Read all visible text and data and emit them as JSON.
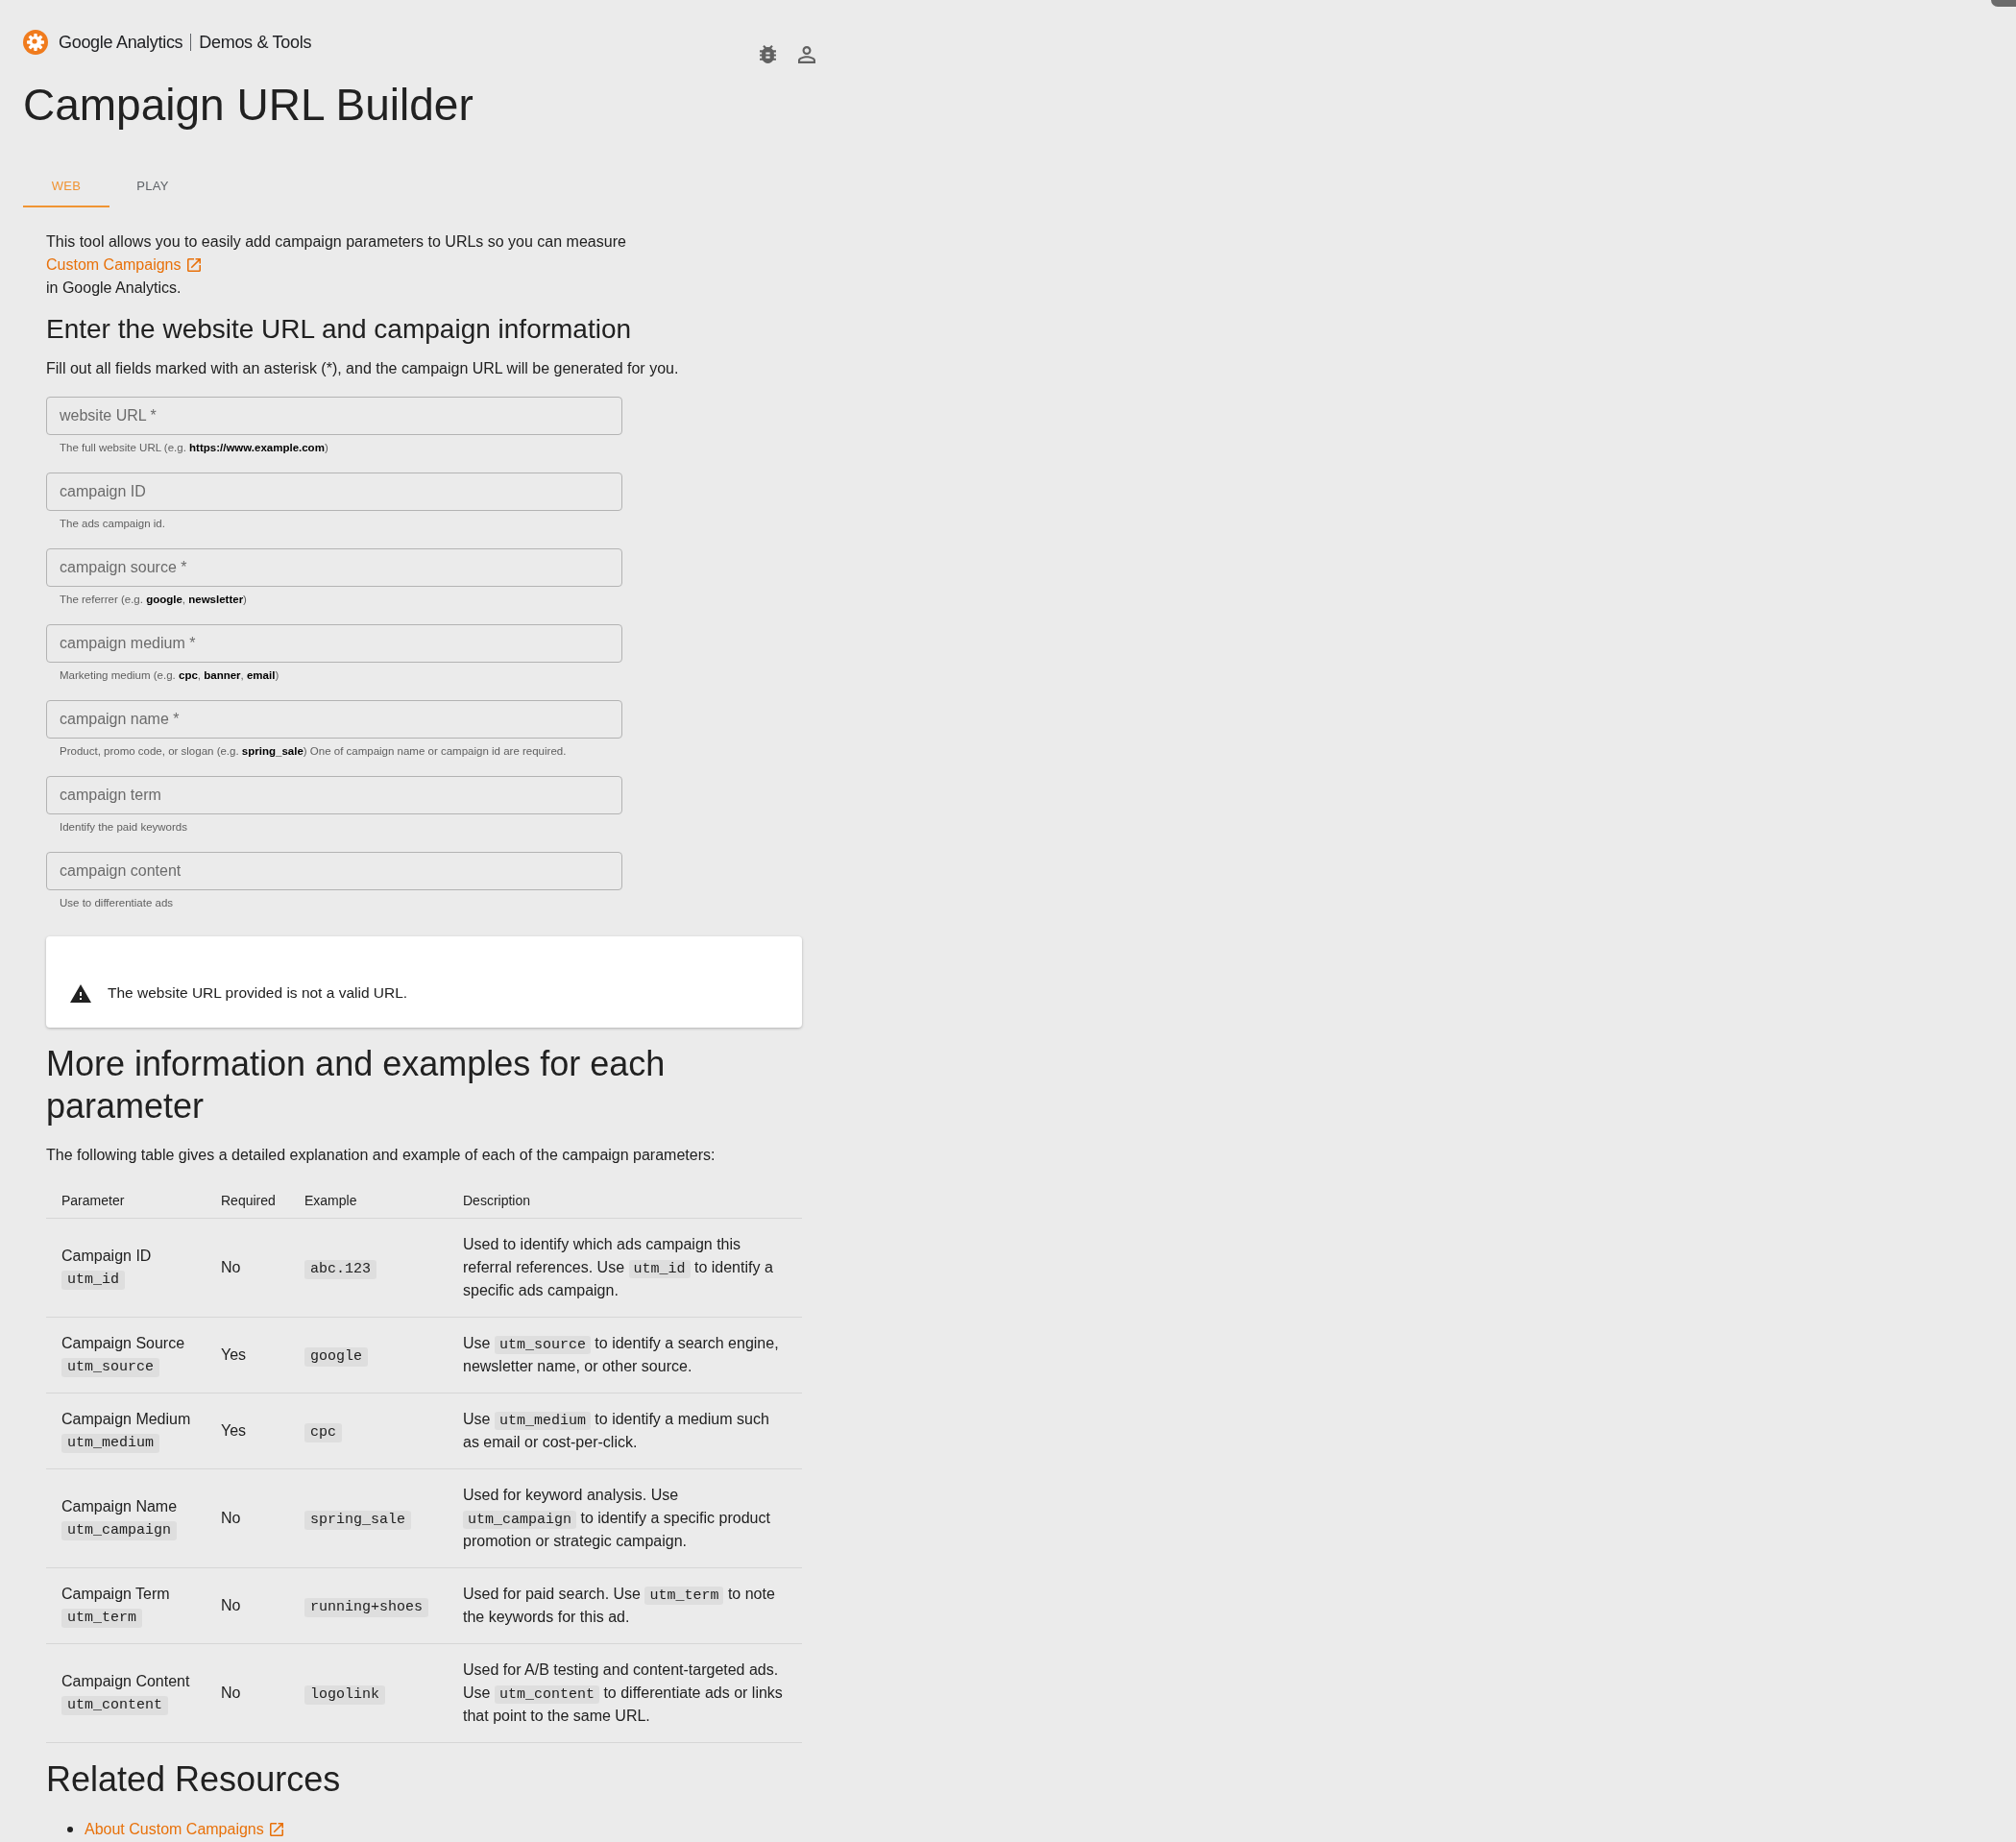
{
  "brand": {
    "product": "Google Analytics",
    "section": "Demos & Tools"
  },
  "title": "Campaign URL Builder",
  "tabs": [
    {
      "label": "WEB",
      "selected": true
    },
    {
      "label": "PLAY",
      "selected": false
    }
  ],
  "intro": {
    "before": "This tool allows you to easily add campaign parameters to URLs so you can measure",
    "link": "Custom Campaigns",
    "after": "in Google Analytics."
  },
  "form": {
    "heading": "Enter the website URL and campaign information",
    "instructions": "Fill out all fields marked with an asterisk (*), and the campaign URL will be generated for you.",
    "fields": [
      {
        "placeholder": "website URL *",
        "helper": "The full website URL (e.g. **https://www.example.com**)"
      },
      {
        "placeholder": "campaign ID",
        "helper": "The ads campaign id."
      },
      {
        "placeholder": "campaign source *",
        "helper": "The referrer (e.g. **google**, **newsletter**)"
      },
      {
        "placeholder": "campaign medium *",
        "helper": "Marketing medium (e.g. **cpc**, **banner**, **email**)"
      },
      {
        "placeholder": "campaign name *",
        "helper": "Product, promo code, or slogan (e.g. **spring_sale**) One of campaign name or campaign id are required."
      },
      {
        "placeholder": "campaign term",
        "helper": "Identify the paid keywords"
      },
      {
        "placeholder": "campaign content",
        "helper": "Use to differentiate ads"
      }
    ]
  },
  "alert": {
    "kind": "warning",
    "message": "The website URL provided is not a valid URL."
  },
  "parameters": {
    "heading": "More information and examples for each parameter",
    "intro": "The following table gives a detailed explanation and example of each of the campaign parameters:",
    "table": {
      "columns": [
        "Parameter",
        "Required",
        "Example",
        "Description"
      ],
      "rows": [
        {
          "name": "Campaign ID",
          "code": "utm_id",
          "required": "No",
          "example": "abc.123",
          "description": [
            {
              "kind": "text",
              "text": "Used to identify which ads campaign this referral references. Use "
            },
            {
              "kind": "code",
              "text": "utm_id"
            },
            {
              "kind": "text",
              "text": " to identify a specific ads campaign."
            }
          ]
        },
        {
          "name": "Campaign Source",
          "code": "utm_source",
          "required": "Yes",
          "example": "google",
          "description": [
            {
              "kind": "text",
              "text": "Use "
            },
            {
              "kind": "code",
              "text": "utm_source"
            },
            {
              "kind": "text",
              "text": " to identify a search engine, newsletter name, or other source."
            }
          ]
        },
        {
          "name": "Campaign Medium",
          "code": "utm_medium",
          "required": "Yes",
          "example": "cpc",
          "description": [
            {
              "kind": "text",
              "text": "Use "
            },
            {
              "kind": "code",
              "text": "utm_medium"
            },
            {
              "kind": "text",
              "text": " to identify a medium such as email or cost-per-click."
            }
          ]
        },
        {
          "name": "Campaign Name",
          "code": "utm_campaign",
          "required": "No",
          "example": "spring_sale",
          "description": [
            {
              "kind": "text",
              "text": "Used for keyword analysis. Use "
            },
            {
              "kind": "code",
              "text": "utm_campaign"
            },
            {
              "kind": "text",
              "text": " to identify a specific product promotion or strategic campaign."
            }
          ]
        },
        {
          "name": "Campaign Term",
          "code": "utm_term",
          "required": "No",
          "example": "running+shoes",
          "description": [
            {
              "kind": "text",
              "text": "Used for paid search. Use "
            },
            {
              "kind": "code",
              "text": "utm_term"
            },
            {
              "kind": "text",
              "text": " to note the keywords for this ad."
            }
          ]
        },
        {
          "name": "Campaign Content",
          "code": "utm_content",
          "required": "No",
          "example": "logolink",
          "description": [
            {
              "kind": "text",
              "text": "Used for A/B testing and content-targeted ads. Use "
            },
            {
              "kind": "code",
              "text": "utm_content"
            },
            {
              "kind": "text",
              "text": " to differentiate ads or links that point to the same URL."
            }
          ]
        }
      ]
    }
  },
  "related": {
    "heading": "Related Resources",
    "links": [
      "About Custom Campaigns"
    ]
  }
}
